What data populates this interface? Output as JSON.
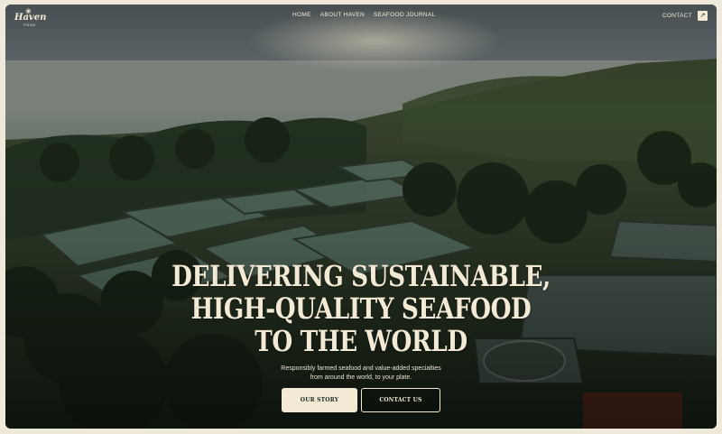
{
  "brand": {
    "wordmark": "Haven",
    "subtext": "FOOD",
    "mark_icon": "lobster-icon"
  },
  "nav": {
    "items": [
      "HOME",
      "ABOUT HAVEN",
      "SEAFOOD JOURNAL"
    ]
  },
  "contact": {
    "label": "CONTACT",
    "icon": "arrow-up-right-icon"
  },
  "hero": {
    "headline_lines": [
      "DELIVERING SUSTAINABLE,",
      "HIGH-QUALITY SEAFOOD",
      "TO THE WORLD"
    ],
    "subtext_lines": [
      "Responsibly farmed seafood and value-added specialties",
      "from around the world, to your plate."
    ],
    "primary_button": "OUR STORY",
    "secondary_button": "CONTACT US",
    "background": "aerial-photo-coastal-aquaculture-ponds"
  },
  "colors": {
    "cream": "#f3ead6",
    "dark_green": "#1c2a22",
    "page_background": "#efe9dc"
  }
}
